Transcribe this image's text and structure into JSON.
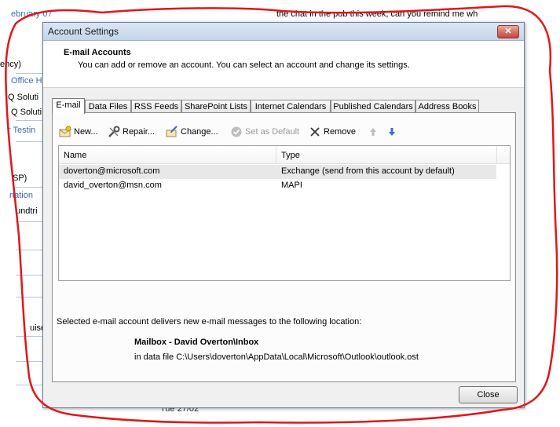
{
  "background": {
    "date_fragment": "ebruary 07",
    "chat_fragment": "the chat in the pub this week, can you remind me wh",
    "left_fragments": [
      "ency)",
      "Office H",
      "Q Soluti",
      "Q Soluti",
      "r Testin",
      "",
      "SP)",
      "nation",
      "undtri",
      "",
      "",
      "",
      "",
      "uise"
    ],
    "bottom_date": "Tue 27/02"
  },
  "dialog": {
    "title": "Account Settings",
    "close_glyph": "✕",
    "header_title": "E-mail Accounts",
    "header_subtitle": "You can add or remove an account. You can select an account and change its settings.",
    "tabs": [
      "E-mail",
      "Data Files",
      "RSS Feeds",
      "SharePoint Lists",
      "Internet Calendars",
      "Published Calendars",
      "Address Books"
    ],
    "active_tab": "E-mail",
    "toolbar": {
      "new_label": "New...",
      "repair_label": "Repair...",
      "change_label": "Change...",
      "default_label": "Set as Default",
      "remove_label": "Remove"
    },
    "list": {
      "col_name": "Name",
      "col_type": "Type",
      "rows": [
        {
          "name": "doverton@microsoft.com",
          "type": "Exchange (send from this account by default)"
        },
        {
          "name": "david_overton@msn.com",
          "type": "MAPI"
        }
      ]
    },
    "delivery_info": "Selected e-mail account delivers new e-mail messages to the following location:",
    "mailbox": "Mailbox - David Overton\\Inbox",
    "data_file": "in data file C:\\Users\\doverton\\AppData\\Local\\Microsoft\\Outlook\\outlook.ost",
    "close_label": "Close"
  },
  "colors": {
    "accent_blue": "#3d6aa8",
    "scribble_red": "#e0161b",
    "disabled_gray": "#9a9a9a"
  }
}
